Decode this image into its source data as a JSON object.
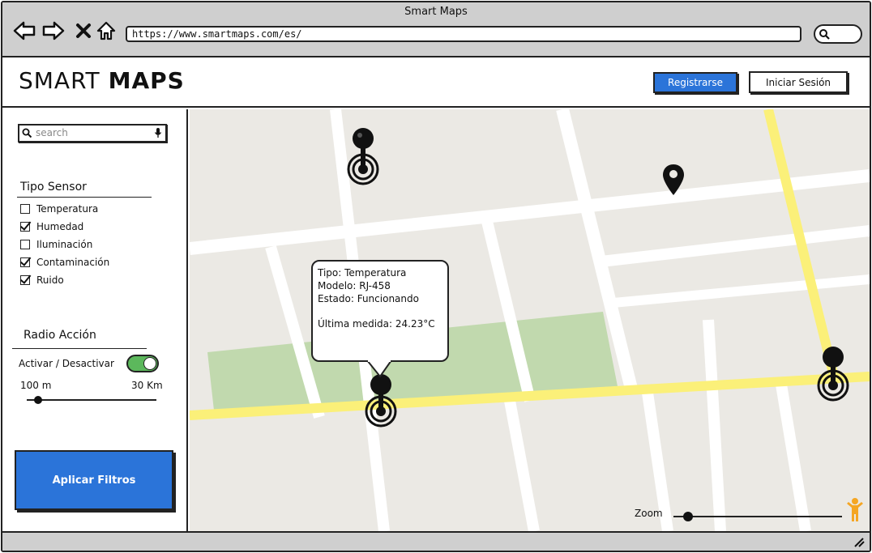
{
  "window": {
    "title": "Smart Maps"
  },
  "browser": {
    "url": "https://www.smartmaps.com/es/"
  },
  "header": {
    "logo_light": "SMART",
    "logo_bold": "MAPS",
    "register_label": "Registrarse",
    "login_label": "Iniciar Sesión",
    "accent_color": "#2b74d9"
  },
  "sidebar": {
    "search": {
      "placeholder": "search",
      "value": ""
    },
    "sensor_type": {
      "title": "Tipo Sensor",
      "options": [
        {
          "label": "Temperatura",
          "checked": false
        },
        {
          "label": "Humedad",
          "checked": true
        },
        {
          "label": "Iluminación",
          "checked": false
        },
        {
          "label": "Contaminación",
          "checked": true
        },
        {
          "label": "Ruido",
          "checked": true
        }
      ]
    },
    "radius": {
      "title": "Radio Acción",
      "toggle_label": "Activar / Desactivar",
      "toggle_on": true,
      "toggle_color": "#5cb85c",
      "min_label": "100 m",
      "max_label": "30 Km",
      "value_fraction": 0.08
    },
    "apply_label": "Aplicar Filtros"
  },
  "map": {
    "tooltip": {
      "tipo": "Tipo: Temperatura",
      "modelo": "Modelo: RJ-458",
      "estado": "Estado: Funcionando",
      "medida": "Última medida: 24.23°C"
    },
    "zoom": {
      "label": "Zoom",
      "value_fraction": 0.08
    },
    "icons": [
      "sensor-pin-icon",
      "location-marker-icon",
      "person-icon"
    ],
    "road_color": "#fbf079",
    "park_color": "#c1d9ae"
  }
}
